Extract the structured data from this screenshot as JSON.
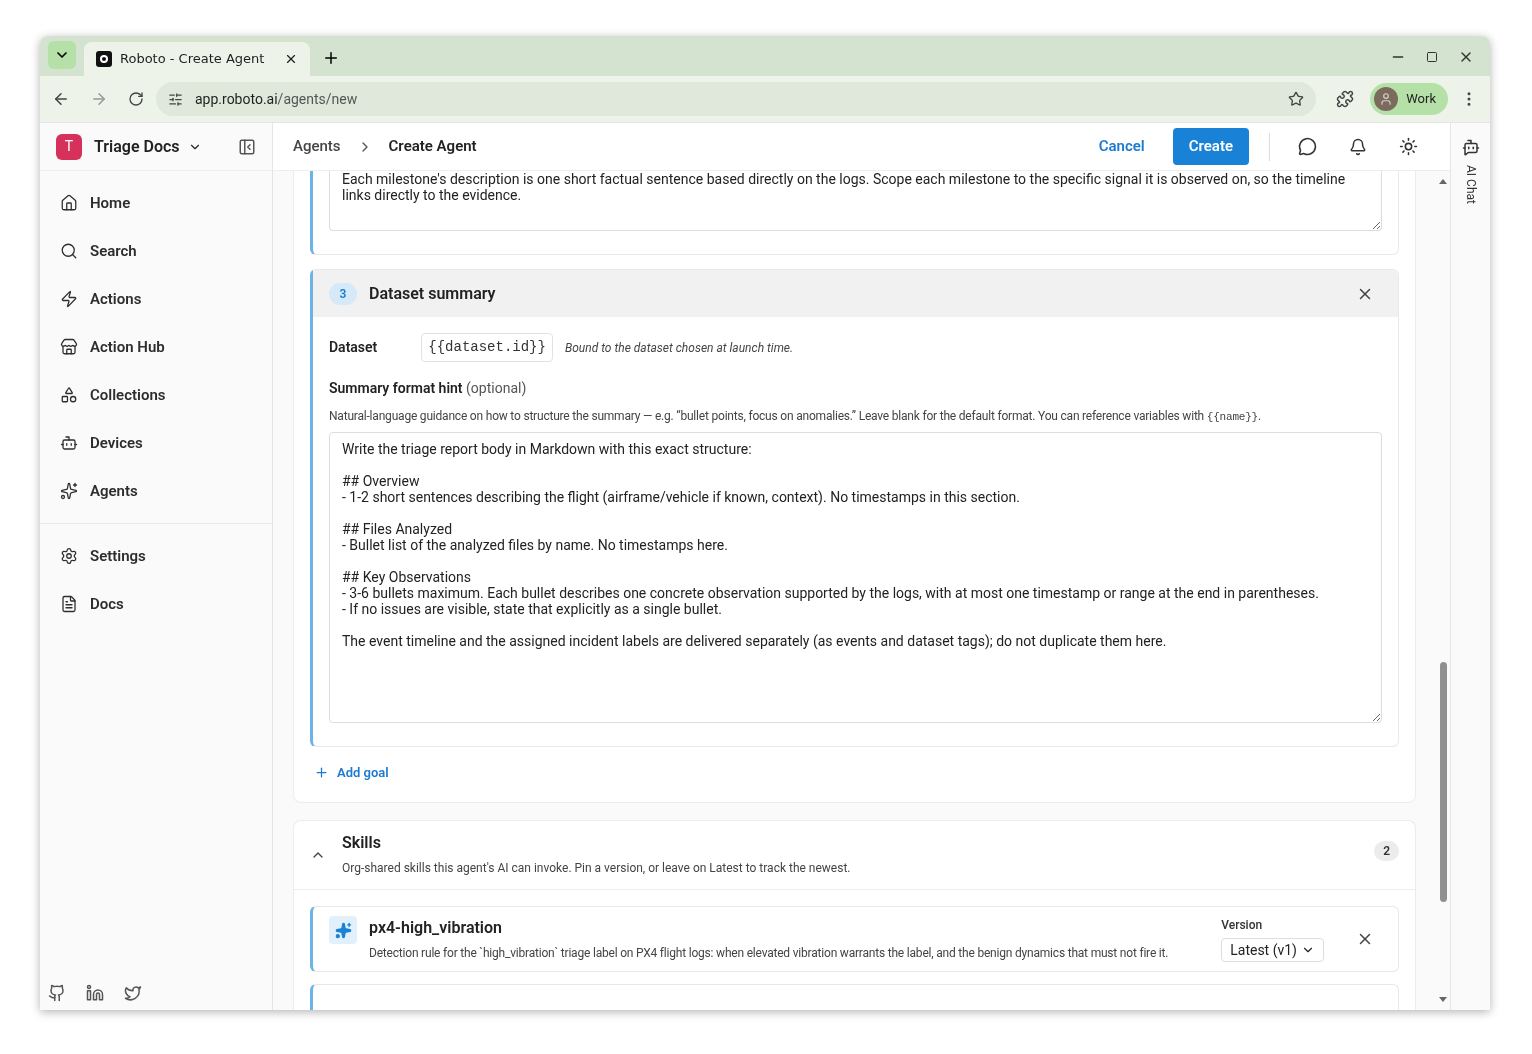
{
  "browser": {
    "tab_title": "Roboto - Create Agent",
    "url_host": "app.roboto.ai",
    "url_path": "/agents/new",
    "profile": "Work"
  },
  "workspace": {
    "initial": "T",
    "name": "Triage Docs"
  },
  "sidebar": {
    "items": [
      {
        "label": "Home",
        "kind": "home"
      },
      {
        "label": "Search",
        "kind": "search"
      },
      {
        "label": "Actions",
        "kind": "actions"
      },
      {
        "label": "Action Hub",
        "kind": "hub"
      },
      {
        "label": "Collections",
        "kind": "collections"
      },
      {
        "label": "Devices",
        "kind": "devices"
      },
      {
        "label": "Agents",
        "kind": "agents"
      }
    ],
    "bottom_items": [
      {
        "label": "Settings",
        "kind": "settings"
      },
      {
        "label": "Docs",
        "kind": "docs"
      }
    ]
  },
  "breadcrumbs": [
    "Agents",
    "Create Agent"
  ],
  "actions": {
    "cancel": "Cancel",
    "create": "Create"
  },
  "ai_chat": "AI Chat",
  "previous_goal": {
    "prompt": "Each milestone's description is one short factual sentence based directly on the logs. Scope each milestone to the specific signal it is observed on, so the timeline links directly to the evidence."
  },
  "goal": {
    "number": "3",
    "title": "Dataset summary",
    "dataset_label": "Dataset",
    "dataset_value": "{{dataset.id}}",
    "dataset_note": "Bound to the dataset chosen at launch time.",
    "hint_label": "Summary format hint",
    "hint_optional": "(optional)",
    "hint_help": "Natural-language guidance on how to structure the summary — e.g. “bullet points, focus on anomalies.” Leave blank for the default format. You can reference variables with",
    "hint_help_code": "{{name}}",
    "hint_help_end": ".",
    "value": "Write the triage report body in Markdown with this exact structure:\n\n## Overview\n- 1-2 short sentences describing the flight (airframe/vehicle if known, context). No timestamps in this section.\n\n## Files Analyzed\n- Bullet list of the analyzed files by name. No timestamps here.\n\n## Key Observations\n- 3-6 bullets maximum. Each bullet describes one concrete observation supported by the logs, with at most one timestamp or range at the end in parentheses.\n- If no issues are visible, state that explicitly as a single bullet.\n\nThe event timeline and the assigned incident labels are delivered separately (as events and dataset tags); do not duplicate them here."
  },
  "add_goal": "Add goal",
  "skills": {
    "title": "Skills",
    "subtitle": "Org-shared skills this agent's AI can invoke. Pin a version, or leave on Latest to track the newest.",
    "count": "2",
    "expanded": true,
    "items": [
      {
        "name": "px4-high_vibration",
        "description": "Detection rule for the `high_vibration` triage label on PX4 flight logs: when elevated vibration warrants the label, and the benign dynamics that must not fire it.",
        "version_label": "Version",
        "version": "Latest (v1)"
      }
    ]
  }
}
